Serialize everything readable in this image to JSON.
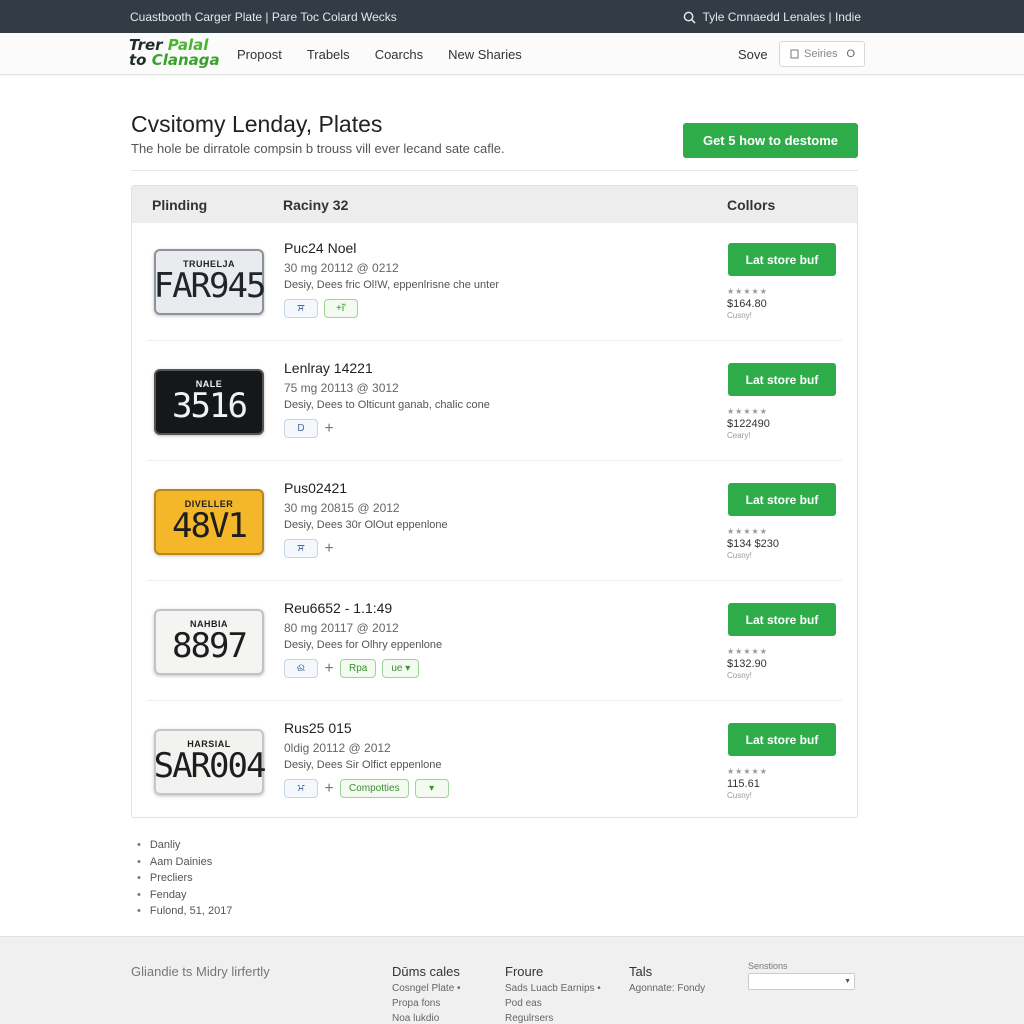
{
  "topbar": {
    "left_text": "Cuastbooth Carger Plate  |  Pare Toc Colard Wecks",
    "right_text": "Tyle Cmnaedd Lenales  |  Indie",
    "search_icon": "search-icon"
  },
  "nav": {
    "logo_line1_a": "Trer ",
    "logo_line1_b": "Palal",
    "logo_line2_a": "to ",
    "logo_line2_b": "Clanaga",
    "links": [
      "Propost",
      "Trabels",
      "Coarchs",
      "New Sharies"
    ],
    "save": "Sove",
    "search_placeholder": "Seiries",
    "search_trailing": "O"
  },
  "header": {
    "title": "Cvsitomy Lenday, Plates",
    "subtitle": "The hole be dirratole compsin b trouss vill ever lecand sate cafle.",
    "cta": "Get 5 how to destome"
  },
  "table": {
    "columns": [
      "Plinding",
      "Raciny 32",
      "Collors"
    ],
    "rows": [
      {
        "plate_top": "TRUHELJA",
        "plate_num": "FAR945",
        "plate_bg": "#e9ebee",
        "plate_fg": "#20252c",
        "plate_border": "#8d939b",
        "name": "Puc24 Noel",
        "date": "30 mg  20112 @ 0212",
        "desc": "Desiy, Dees fric Ol!W, eppenlrisne che unter",
        "chips": [
          {
            "t": "ਸ",
            "k": "b"
          },
          {
            "t": "+ǐ'",
            "k": "g"
          }
        ],
        "buy": "Lat store buf",
        "stars": "★★★★★",
        "price": "$164.80",
        "qty": "Cusny!"
      },
      {
        "plate_top": "NALE",
        "plate_num": "3516",
        "plate_bg": "#15181b",
        "plate_fg": "#f2f2f2",
        "plate_border": "#555",
        "name": "Lenlray 14221",
        "date": "75 mg  20113 @ 3012",
        "desc": "Desiy, Dees to Olticunt ganab, chalic cone",
        "chips": [
          {
            "t": "D",
            "k": "b"
          },
          {
            "t": "+",
            "k": "p"
          }
        ],
        "buy": "Lat store buf",
        "stars": "★★★★★",
        "price": "$122490",
        "qty": "Ceary!"
      },
      {
        "plate_top": "DIVELLER",
        "plate_num": "48V1",
        "plate_bg": "#f4b729",
        "plate_fg": "#1e1e1e",
        "plate_border": "#b8861b",
        "name": "Pus02421",
        "date": "30 mg  20815 @ 2012",
        "desc": "Desiy, Dees 30r OlOut eppenlone",
        "chips": [
          {
            "t": "ਸ",
            "k": "b"
          },
          {
            "t": "+",
            "k": "p"
          }
        ],
        "buy": "Lat store buf",
        "stars": "★★★★★",
        "price": "$134 $230",
        "qty": "Cusny!"
      },
      {
        "plate_top": "NAHBIA",
        "plate_num": "8897",
        "plate_bg": "#f4f4f2",
        "plate_fg": "#1d1d1d",
        "plate_border": "#c2c2c2",
        "name": "Reu6652 - 1.1:49",
        "date": "80 mg  20117 @ 2012",
        "desc": "Desiy, Dees for Olhry eppenlone",
        "chips": [
          {
            "t": "ଈ",
            "k": "b"
          },
          {
            "t": "+",
            "k": "p"
          },
          {
            "t": "Rpa",
            "k": "g"
          },
          {
            "t": "ue ▾",
            "k": "g"
          }
        ],
        "buy": "Lat store buf",
        "stars": "★★★★★",
        "price": "$132.90",
        "qty": "Cosny!"
      },
      {
        "plate_top": "HARSIAL",
        "plate_num": "SAR004",
        "plate_bg": "#f2f2f0",
        "plate_fg": "#1d1d1d",
        "plate_border": "#c6c6c6",
        "name": "Rus25 015",
        "date": "0ldig  20112 @ 2012",
        "desc": "Desiy, Dees Sir Olfict eppenlone",
        "chips": [
          {
            "t": "ਮ",
            "k": "b"
          },
          {
            "t": "+",
            "k": "p"
          },
          {
            "t": "Compotties",
            "k": "g"
          },
          {
            "t": "▾",
            "k": "g"
          }
        ],
        "buy": "Lat store buf",
        "stars": "★★★★★",
        "price": "115.61",
        "qty": "Cusny!"
      }
    ]
  },
  "bullets": [
    "Danliy",
    "Aam Dainies",
    "Precliers",
    "Fenday",
    "Fulond, 51, 2017"
  ],
  "footer": {
    "tagline": "Gliandie ts Midry lirfertly",
    "col1": {
      "h": "Dūms cales",
      "items": [
        "Cosngel Plate •",
        "Propa fons",
        "Noa lukdio"
      ]
    },
    "col2": {
      "h": "Froure",
      "items": [
        "Sads Luacb Earnips •",
        "Pod eas",
        "Regulrsers"
      ]
    },
    "col3": {
      "h": "Tals",
      "items": [
        "Agonnate: Fondy"
      ]
    },
    "select_label": "Senstions",
    "select_value": ""
  }
}
